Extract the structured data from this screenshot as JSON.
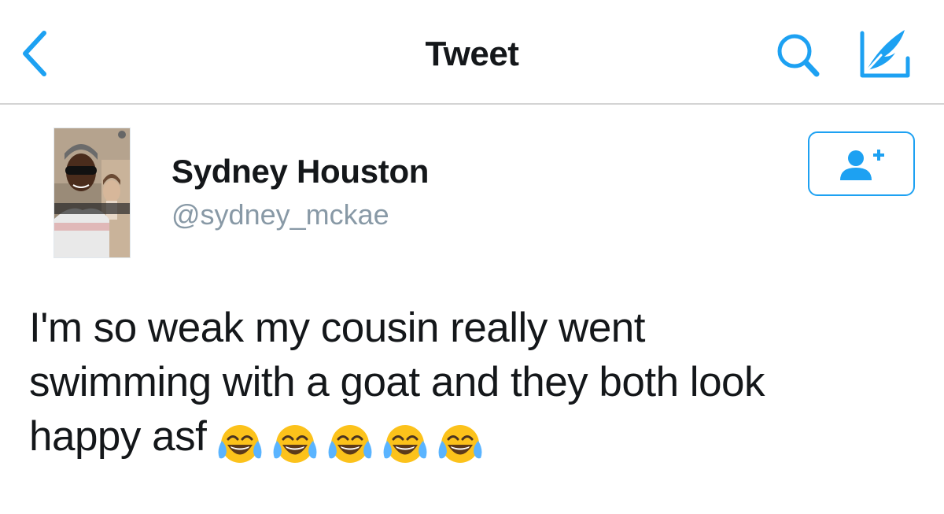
{
  "nav": {
    "title": "Tweet",
    "icons": {
      "back": "chevron-left-icon",
      "search": "search-icon",
      "compose": "compose-quill-icon"
    }
  },
  "author": {
    "display_name": "Sydney Houston",
    "username": "@sydney_mckae",
    "avatar": "avatar-photo"
  },
  "follow_button": {
    "icon": "add-user-icon"
  },
  "tweet": {
    "text_line1": "I'm so weak my cousin really went",
    "text_line2": "swimming with a goat and they both look",
    "text_line3": "happy asf",
    "emoji": "face-with-tears-of-joy",
    "emoji_count": 5
  },
  "colors": {
    "accent": "#1da1f2",
    "text": "#14171a",
    "secondary_text": "#8899a6",
    "divider": "#d4d4d4"
  }
}
